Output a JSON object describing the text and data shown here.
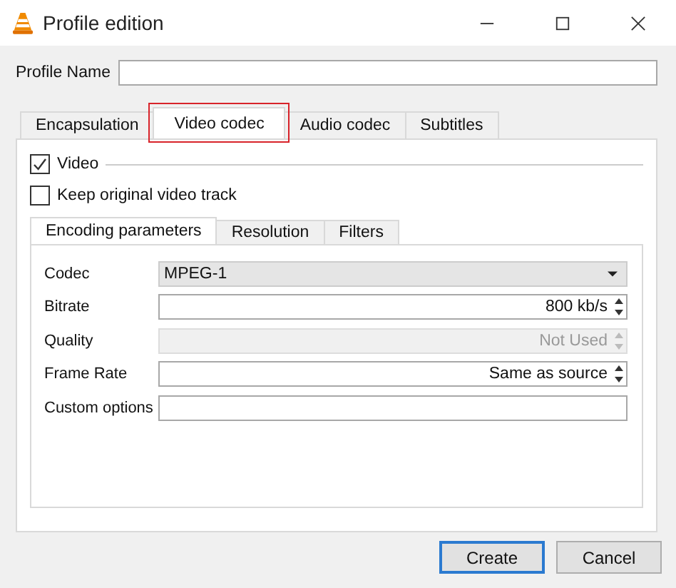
{
  "window": {
    "title": "Profile edition"
  },
  "profile_name": {
    "label": "Profile Name"
  },
  "tabs": [
    {
      "label": "Encapsulation",
      "selected": false,
      "highlighted": false
    },
    {
      "label": "Video codec",
      "selected": true,
      "highlighted": true
    },
    {
      "label": "Audio codec",
      "selected": false,
      "highlighted": false
    },
    {
      "label": "Subtitles",
      "selected": false,
      "highlighted": false
    }
  ],
  "video": {
    "label": "Video",
    "checked": true
  },
  "keep_original": {
    "label": "Keep original video track",
    "checked": false
  },
  "inner_tabs": [
    {
      "label": "Encoding parameters",
      "selected": true
    },
    {
      "label": "Resolution",
      "selected": false
    },
    {
      "label": "Filters",
      "selected": false
    }
  ],
  "fields": [
    {
      "label": "Codec",
      "kind": "dropdown",
      "value": "MPEG-1",
      "disabled": false
    },
    {
      "label": "Bitrate",
      "kind": "spin",
      "value": "800 kb/s",
      "disabled": false
    },
    {
      "label": "Quality",
      "kind": "spin",
      "value": "Not Used",
      "disabled": true
    },
    {
      "label": "Frame Rate",
      "kind": "spin",
      "value": "Same as source",
      "disabled": false
    },
    {
      "label": "Custom options",
      "kind": "text",
      "disabled": false
    }
  ],
  "buttons": [
    {
      "label": "Create",
      "default": true
    },
    {
      "label": "Cancel",
      "default": false
    }
  ]
}
